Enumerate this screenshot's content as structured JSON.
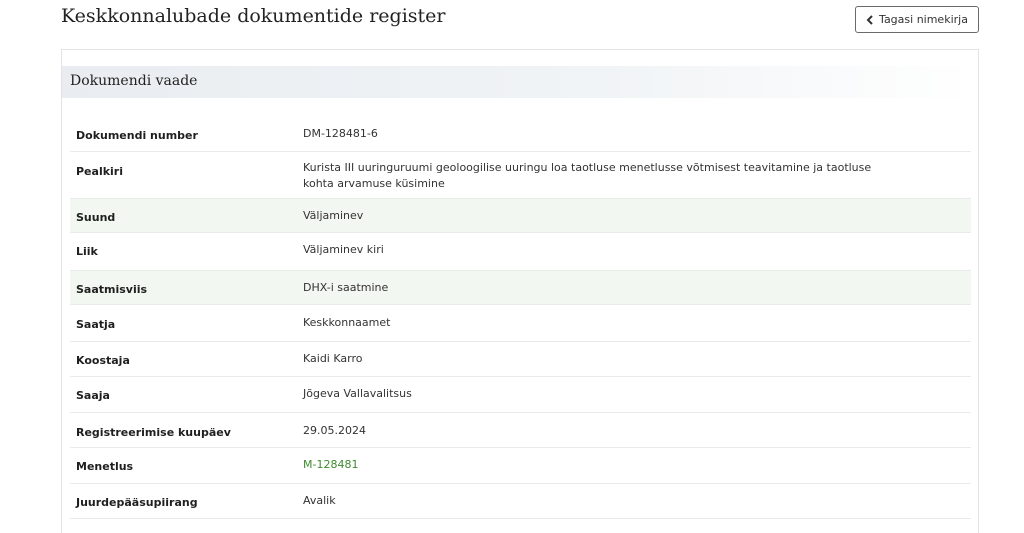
{
  "header": {
    "title": "Keskkonnalubade dokumentide register",
    "back_label": "Tagasi nimekirja"
  },
  "panel": {
    "title": "Dokumendi vaade"
  },
  "rows": [
    {
      "label": "Dokumendi number",
      "value": "DM-128481-6",
      "striped": false,
      "link": false
    },
    {
      "label": "Pealkiri",
      "value": "Kurista III uuringuruumi geoloogilise uuringu loa taotluse menetlusse võtmisest teavitamine ja taotluse kohta arvamuse küsimine",
      "striped": false,
      "link": false
    },
    {
      "label": "Suund",
      "value": "Väljaminev",
      "striped": true,
      "link": false
    },
    {
      "label": "Liik",
      "value": "Väljaminev kiri",
      "striped": false,
      "link": false
    },
    {
      "label": "Saatmisviis",
      "value": "DHX-i saatmine",
      "striped": true,
      "link": false
    },
    {
      "label": "Saatja",
      "value": "Keskkonnaamet",
      "striped": false,
      "link": false
    },
    {
      "label": "Koostaja",
      "value": "Kaidi Karro",
      "striped": false,
      "link": false
    },
    {
      "label": "Saaja",
      "value": "Jõgeva Vallavalitsus",
      "striped": false,
      "link": false
    },
    {
      "label": "Registreerimise kuupäev",
      "value": "29.05.2024",
      "striped": false,
      "link": false
    },
    {
      "label": "Menetlus",
      "value": "M-128481",
      "striped": false,
      "link": true
    },
    {
      "label": "Juurdepääsupiirang",
      "value": "Avalik",
      "striped": false,
      "link": false
    }
  ],
  "colors": {
    "link": "#3d8c2e",
    "stripe": "#f3f7f1",
    "header_bg": "#e9edf1"
  },
  "icons": {
    "back": "chevron-left-icon"
  }
}
